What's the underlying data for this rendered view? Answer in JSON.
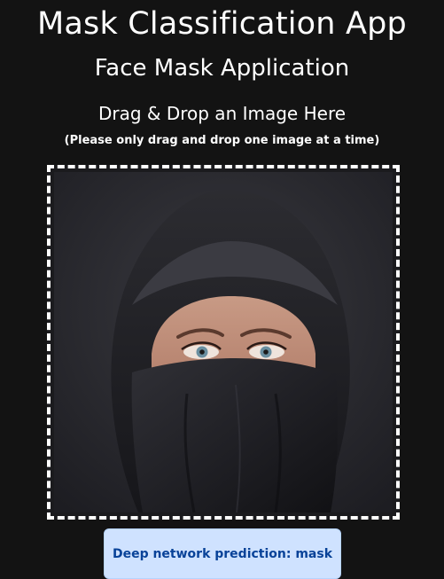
{
  "header": {
    "title": "Mask Classification App",
    "subtitle": "Face Mask Application"
  },
  "dropzone": {
    "heading": "Drag & Drop an Image Here",
    "note": "(Please only drag and drop one image at a time)",
    "image_description": "woman-wearing-black-niqab-face-covering"
  },
  "result": {
    "prediction_text": "Deep network prediction: mask"
  },
  "colors": {
    "background": "#131313",
    "alert_bg": "#cfe2ff",
    "alert_text": "#084298"
  }
}
